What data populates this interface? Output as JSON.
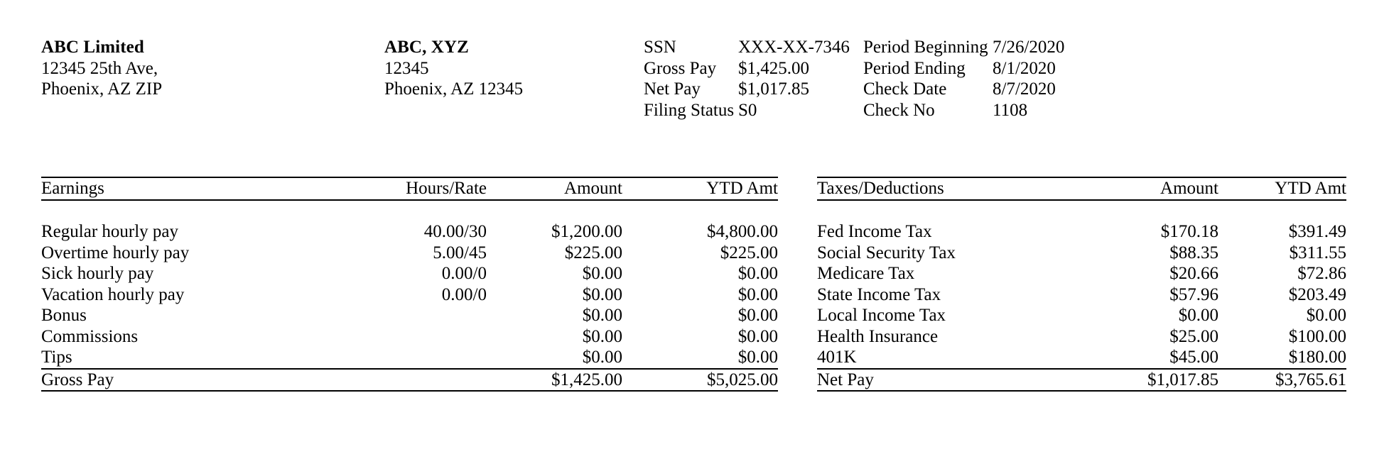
{
  "company": {
    "name": "ABC Limited",
    "address_line1": "12345 25th Ave,",
    "address_line2": "Phoenix, AZ ZIP"
  },
  "employee": {
    "name": "ABC, XYZ",
    "address_line1": "12345",
    "address_line2": "Phoenix, AZ 12345"
  },
  "summary": {
    "left": [
      {
        "label": "SSN",
        "value": "XXX-XX-7346"
      },
      {
        "label": "Gross Pay",
        "value": "$1,425.00"
      },
      {
        "label": "Net Pay",
        "value": "$1,017.85"
      },
      {
        "label": "Filing Status",
        "value": "S0"
      }
    ],
    "right": [
      {
        "label": "Period Beginning",
        "value": "7/26/2020"
      },
      {
        "label": "Period Ending",
        "value": "8/1/2020"
      },
      {
        "label": "Check Date",
        "value": "8/7/2020"
      },
      {
        "label": "Check No",
        "value": "1108"
      }
    ]
  },
  "earnings": {
    "headers": [
      "Earnings",
      "Hours/Rate",
      "Amount",
      "YTD Amt"
    ],
    "rows": [
      {
        "label": "Regular hourly pay",
        "hours_rate": "40.00/30",
        "amount": "$1,200.00",
        "ytd": "$4,800.00"
      },
      {
        "label": "Overtime hourly pay",
        "hours_rate": "5.00/45",
        "amount": "$225.00",
        "ytd": "$225.00"
      },
      {
        "label": "Sick hourly pay",
        "hours_rate": "0.00/0",
        "amount": "$0.00",
        "ytd": "$0.00"
      },
      {
        "label": "Vacation hourly pay",
        "hours_rate": "0.00/0",
        "amount": "$0.00",
        "ytd": "$0.00"
      },
      {
        "label": "Bonus",
        "hours_rate": "",
        "amount": "$0.00",
        "ytd": "$0.00"
      },
      {
        "label": "Commissions",
        "hours_rate": "",
        "amount": "$0.00",
        "ytd": "$0.00"
      },
      {
        "label": "Tips",
        "hours_rate": "",
        "amount": "$0.00",
        "ytd": "$0.00"
      }
    ],
    "total": {
      "label": "Gross Pay",
      "hours_rate": "",
      "amount": "$1,425.00",
      "ytd": "$5,025.00"
    }
  },
  "deductions": {
    "headers": [
      "Taxes/Deductions",
      "Amount",
      "YTD Amt"
    ],
    "rows": [
      {
        "label": "Fed Income Tax",
        "amount": "$170.18",
        "ytd": "$391.49"
      },
      {
        "label": "Social Security Tax",
        "amount": "$88.35",
        "ytd": "$311.55"
      },
      {
        "label": "Medicare Tax",
        "amount": "$20.66",
        "ytd": "$72.86"
      },
      {
        "label": "State Income Tax",
        "amount": "$57.96",
        "ytd": "$203.49"
      },
      {
        "label": "Local Income Tax",
        "amount": "$0.00",
        "ytd": "$0.00"
      },
      {
        "label": "Health Insurance",
        "amount": "$25.00",
        "ytd": "$100.00"
      },
      {
        "label": "401K",
        "amount": "$45.00",
        "ytd": "$180.00"
      }
    ],
    "total": {
      "label": "Net Pay",
      "amount": "$1,017.85",
      "ytd": "$3,765.61"
    }
  },
  "colors": {
    "text": "#000000",
    "background": "#ffffff",
    "rule": "#000000"
  }
}
